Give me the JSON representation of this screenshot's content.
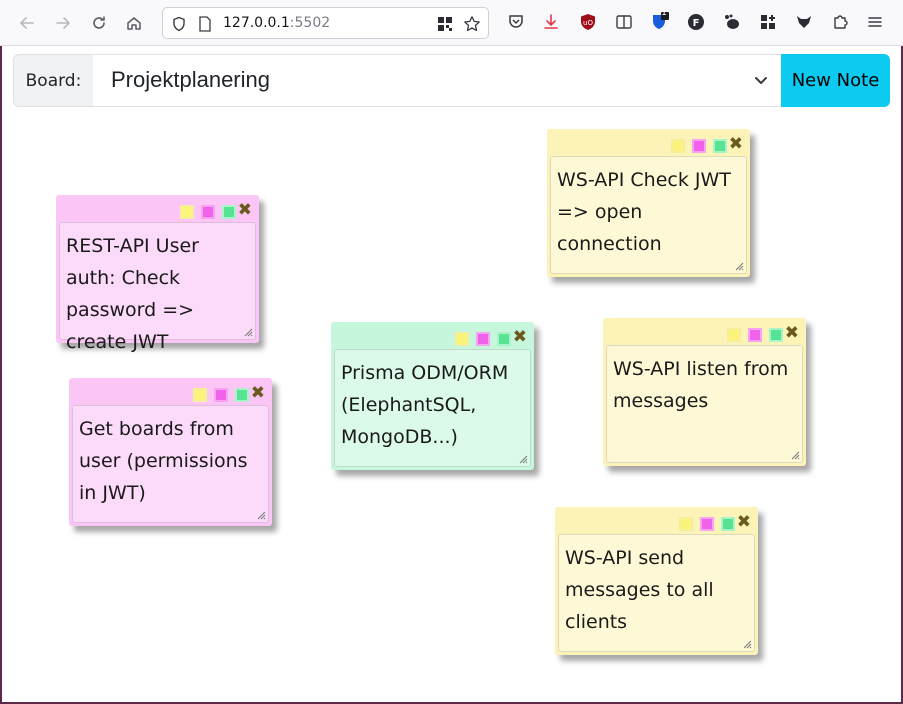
{
  "browser": {
    "url_host": "127.0.0.1",
    "url_port": ":5502",
    "extension_badge": "1"
  },
  "board": {
    "label": "Board:",
    "selected": "Projektplanering",
    "new_note_label": "New Note"
  },
  "notes": [
    {
      "color": "pink",
      "text": "REST-API User auth: Check password => create JWT"
    },
    {
      "color": "pink",
      "text": "Get boards from user (permissions in JWT)"
    },
    {
      "color": "green",
      "text": "Prisma ODM/ORM (ElephantSQL, MongoDB...)"
    },
    {
      "color": "yellow",
      "text": "WS-API Check JWT => open connection"
    },
    {
      "color": "yellow",
      "text": "WS-API listen from messages"
    },
    {
      "color": "yellow",
      "text": "WS-API send messages to all clients"
    }
  ],
  "note_close_symbol": "✖",
  "colors": {
    "pink": "#fbc6f5",
    "yellow": "#fbf3b8",
    "green": "#c6f7dc",
    "new_note_button": "#0dcaf0"
  }
}
